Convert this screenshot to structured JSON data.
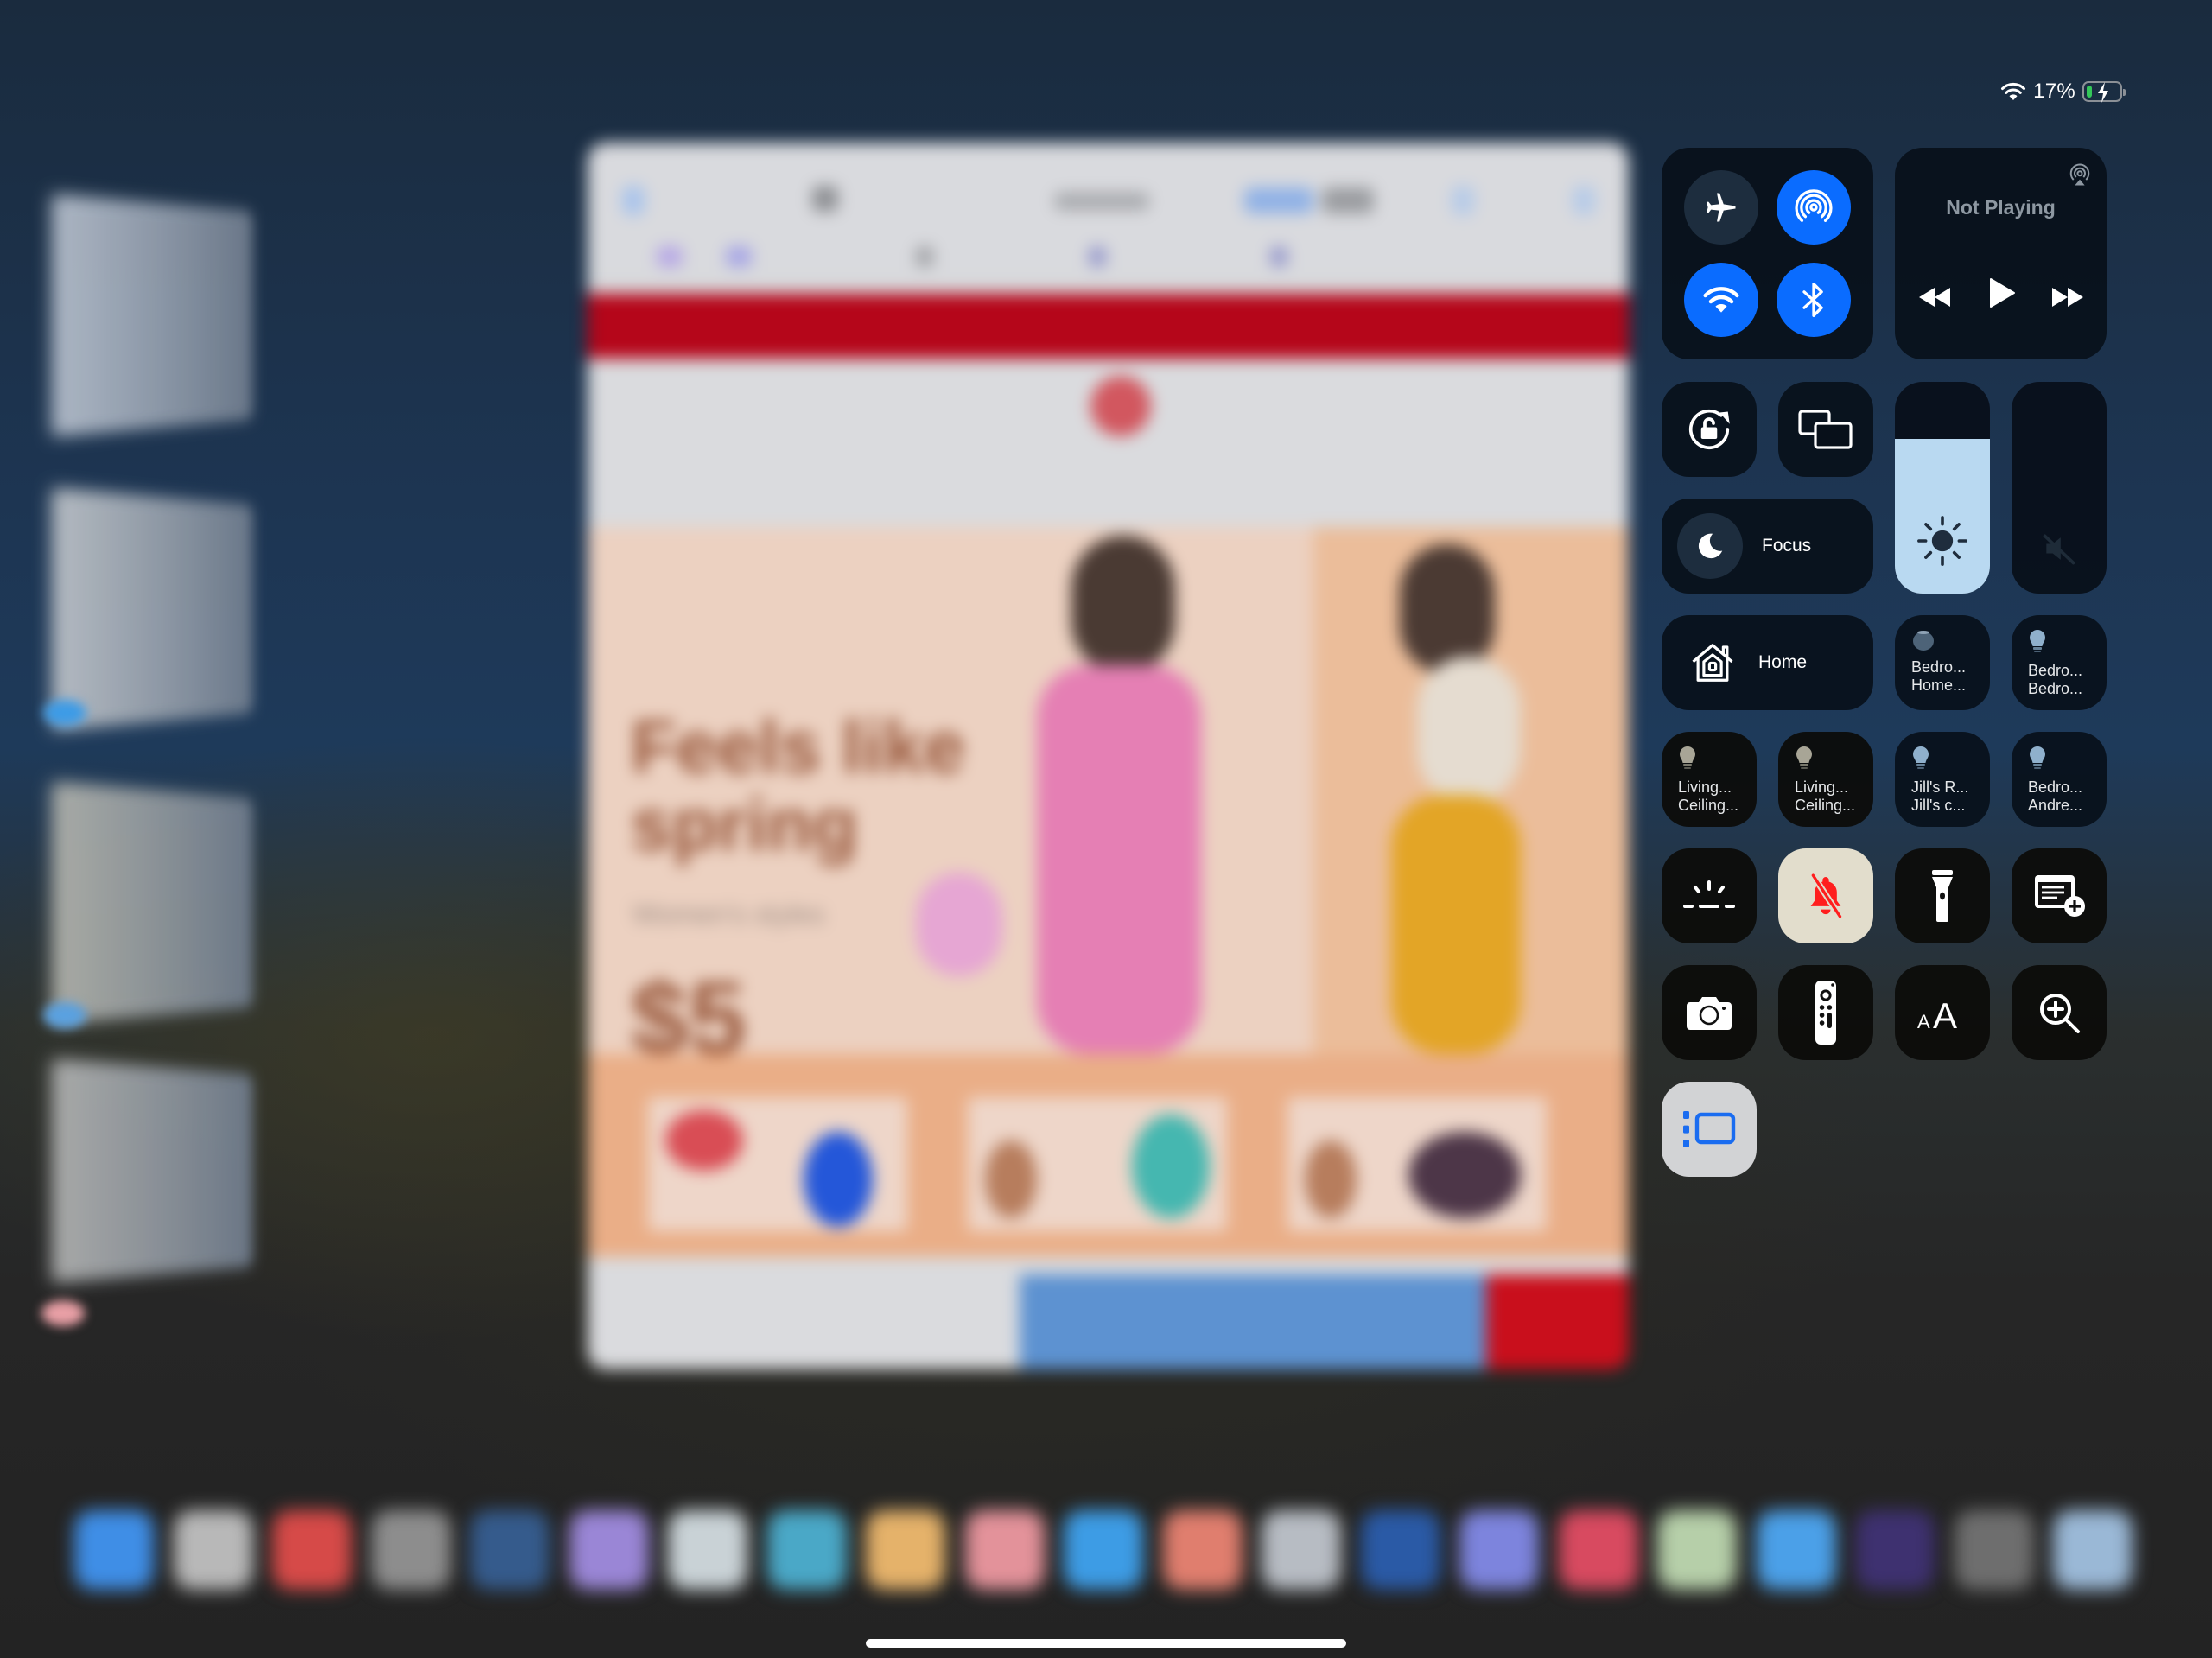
{
  "status_bar": {
    "wifi_icon": "wifi-icon",
    "battery_percent_label": "17%",
    "battery_level": 0.17,
    "charging": true,
    "battery_fill_color": "#34c759"
  },
  "app_switcher": {
    "stack_cards": [
      {
        "name": "stack-card-1",
        "color": "#b9c2cf"
      },
      {
        "name": "stack-card-2",
        "color": "#c1c6cb"
      },
      {
        "name": "stack-card-3",
        "color": "#b4b5ae"
      },
      {
        "name": "stack-card-4",
        "color": "#b3b4b3"
      }
    ],
    "browser_window": {
      "headline": "Feels like spring",
      "subline": "Women's styles",
      "price": "$5",
      "promo_bar_color": "#b5061a"
    }
  },
  "control_center": {
    "connectivity": {
      "airplane_mode": {
        "icon": "airplane-icon",
        "on": false
      },
      "airdrop": {
        "icon": "airdrop-icon",
        "on": true
      },
      "wifi": {
        "icon": "wifi-icon",
        "on": true
      },
      "bluetooth": {
        "icon": "bluetooth-icon",
        "on": true
      },
      "accent_color": "#0a6cff"
    },
    "media": {
      "title": "Not Playing",
      "airplay_icon": "airplay-audio-icon",
      "rewind_icon": "rewind-icon",
      "play_icon": "play-icon",
      "forward_icon": "fast-forward-icon"
    },
    "orientation_lock": {
      "icon": "rotation-lock-icon"
    },
    "screen_mirroring": {
      "icon": "screen-mirroring-icon"
    },
    "focus": {
      "label": "Focus",
      "icon": "moon-icon"
    },
    "brightness": {
      "level": 0.73,
      "icon": "sun-icon",
      "fill_color": "#b9d9f1"
    },
    "volume": {
      "level": 0.0,
      "icon": "speaker-muted-icon"
    },
    "home": {
      "label": "Home",
      "icon": "home-icon"
    },
    "accessories": [
      {
        "icon": "homepod-mini-icon",
        "line1": "Bedro...",
        "line2": "Home..."
      },
      {
        "icon": "lightbulb-icon",
        "line1": "Bedro...",
        "line2": "Bedro..."
      },
      {
        "icon": "lightbulb-icon",
        "line1": "Living...",
        "line2": "Ceiling..."
      },
      {
        "icon": "lightbulb-icon",
        "line1": "Living...",
        "line2": "Ceiling..."
      },
      {
        "icon": "lightbulb-icon",
        "line1": "Jill's R...",
        "line2": "Jill's c..."
      },
      {
        "icon": "lightbulb-icon",
        "line1": "Bedro...",
        "line2": "Andre..."
      }
    ],
    "shortcuts": [
      {
        "name": "night-shift-button",
        "icon": "night-shift-icon",
        "on": false
      },
      {
        "name": "silent-mode-button",
        "icon": "bell-slash-icon",
        "on": true,
        "icon_color": "#ff1e1e",
        "bg": "#e2ddcc"
      },
      {
        "name": "flashlight-button",
        "icon": "flashlight-icon",
        "on": false
      },
      {
        "name": "quick-note-button",
        "icon": "quick-note-icon",
        "on": false
      },
      {
        "name": "camera-button",
        "icon": "camera-icon",
        "on": false
      },
      {
        "name": "apple-tv-remote-button",
        "icon": "tv-remote-icon",
        "on": false
      },
      {
        "name": "text-size-button",
        "icon": "text-size-icon",
        "on": false
      },
      {
        "name": "magnifier-button",
        "icon": "magnifier-icon",
        "on": false
      },
      {
        "name": "stage-manager-button",
        "icon": "stage-manager-icon",
        "on": true,
        "icon_color": "#1a6cf0",
        "bg": "#d2d3d5"
      }
    ]
  },
  "dock": {
    "icons": [
      {
        "name": "dock-app-1",
        "color": "#3f8ee6"
      },
      {
        "name": "dock-app-2",
        "color": "#b8b8b8"
      },
      {
        "name": "dock-app-3",
        "color": "#d64a48"
      },
      {
        "name": "dock-app-4",
        "color": "#8d8d8d"
      },
      {
        "name": "dock-app-5",
        "color": "#355b8c"
      },
      {
        "name": "dock-app-6",
        "color": "#9a86d6"
      },
      {
        "name": "dock-app-7",
        "color": "#c9d2d6"
      },
      {
        "name": "dock-app-8",
        "color": "#4aa8c7"
      },
      {
        "name": "dock-app-9",
        "color": "#e5b26a"
      },
      {
        "name": "dock-app-10",
        "color": "#e3929a"
      },
      {
        "name": "dock-app-11",
        "color": "#3d9ce5"
      },
      {
        "name": "dock-app-12",
        "color": "#e07e6e"
      },
      {
        "name": "dock-app-13",
        "color": "#b7bcc3"
      },
      {
        "name": "dock-app-14",
        "color": "#2a5aa6"
      },
      {
        "name": "dock-app-15",
        "color": "#7d84dd"
      },
      {
        "name": "dock-app-16",
        "color": "#d84a60"
      },
      {
        "name": "dock-app-17",
        "color": "#b6cfa9"
      },
      {
        "name": "dock-app-18",
        "color": "#4ba0e8"
      },
      {
        "name": "dock-app-19",
        "color": "#3e3170"
      },
      {
        "name": "dock-app-20",
        "color": "#6e6e6e"
      },
      {
        "name": "dock-app-21",
        "color": "#9ab8d6"
      }
    ]
  }
}
